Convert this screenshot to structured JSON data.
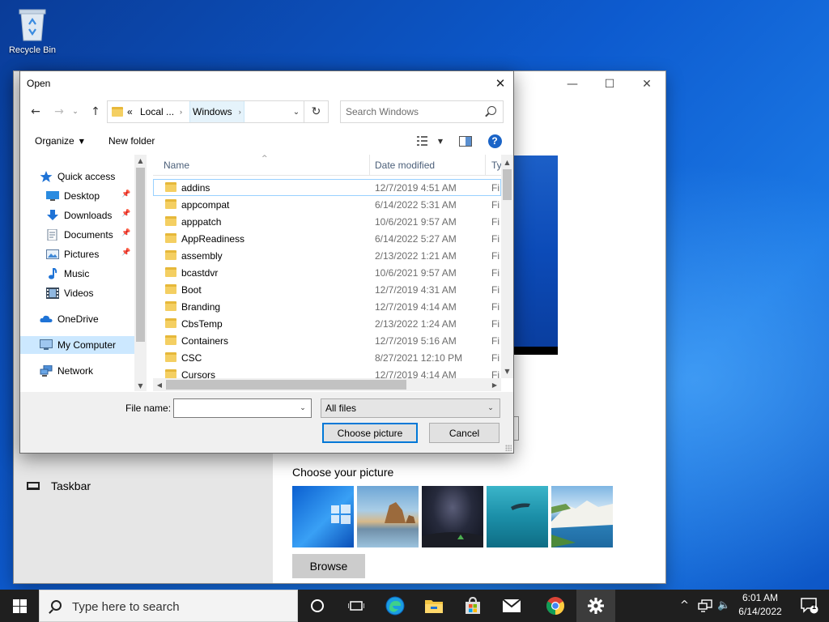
{
  "desktop": {
    "recycle_bin_label": "Recycle Bin"
  },
  "settings": {
    "taskbar_label": "Taskbar",
    "choose_picture_label": "Choose your picture",
    "browse_label": "Browse",
    "minimize": "—",
    "maximize": "☐",
    "close": "✕",
    "thumbnails": [
      "windows-logo-wallpaper",
      "beach-rocks-wallpaper",
      "night-sky-wallpaper",
      "underwater-swimmer-wallpaper",
      "white-cliffs-wallpaper"
    ]
  },
  "dialog": {
    "title": "Open",
    "close": "✕",
    "address": {
      "overflow": "«",
      "segments": [
        "Local ...",
        "Windows"
      ],
      "separator": "›"
    },
    "search_placeholder": "Search Windows",
    "toolbar": {
      "organize": "Organize",
      "new_folder": "New folder"
    },
    "nav_pane": [
      {
        "label": "Quick access",
        "icon": "star-icon",
        "pinned": false
      },
      {
        "label": "Desktop",
        "icon": "desktop-icon",
        "pinned": true
      },
      {
        "label": "Downloads",
        "icon": "download-arrow-icon",
        "pinned": true
      },
      {
        "label": "Documents",
        "icon": "documents-icon",
        "pinned": true
      },
      {
        "label": "Pictures",
        "icon": "pictures-icon",
        "pinned": true
      },
      {
        "label": "Music",
        "icon": "music-note-icon",
        "pinned": false
      },
      {
        "label": "Videos",
        "icon": "film-icon",
        "pinned": false
      },
      {
        "label": "OneDrive",
        "icon": "cloud-icon",
        "pinned": false
      },
      {
        "label": "My Computer",
        "icon": "computer-icon",
        "pinned": false
      },
      {
        "label": "Network",
        "icon": "network-icon",
        "pinned": false
      }
    ],
    "columns": {
      "name": "Name",
      "date": "Date modified",
      "type": "Ty"
    },
    "files": [
      {
        "name": "addins",
        "date": "12/7/2019 4:51 AM",
        "type": "Fi"
      },
      {
        "name": "appcompat",
        "date": "6/14/2022 5:31 AM",
        "type": "Fi"
      },
      {
        "name": "apppatch",
        "date": "10/6/2021 9:57 AM",
        "type": "Fi"
      },
      {
        "name": "AppReadiness",
        "date": "6/14/2022 5:27 AM",
        "type": "Fi"
      },
      {
        "name": "assembly",
        "date": "2/13/2022 1:21 AM",
        "type": "Fi"
      },
      {
        "name": "bcastdvr",
        "date": "10/6/2021 9:57 AM",
        "type": "Fi"
      },
      {
        "name": "Boot",
        "date": "12/7/2019 4:31 AM",
        "type": "Fi"
      },
      {
        "name": "Branding",
        "date": "12/7/2019 4:14 AM",
        "type": "Fi"
      },
      {
        "name": "CbsTemp",
        "date": "2/13/2022 1:24 AM",
        "type": "Fi"
      },
      {
        "name": "Containers",
        "date": "12/7/2019 5:16 AM",
        "type": "Fi"
      },
      {
        "name": "CSC",
        "date": "8/27/2021 12:10 PM",
        "type": "Fi"
      },
      {
        "name": "Cursors",
        "date": "12/7/2019 4:14 AM",
        "type": "Fi"
      }
    ],
    "file_name_label": "File name:",
    "file_name_value": "",
    "file_type": "All files",
    "choose_button": "Choose picture",
    "cancel_button": "Cancel"
  },
  "taskbar": {
    "search_placeholder": "Type here to search",
    "apps": [
      "cortana-circle-icon",
      "task-view-icon",
      "edge-icon",
      "file-explorer-icon",
      "store-icon",
      "mail-icon",
      "chrome-icon",
      "settings-gear-icon"
    ],
    "time": "6:01 AM",
    "date": "6/14/2022",
    "notification_count": "1"
  },
  "colors": {
    "accent": "#0078d7",
    "desktop_blue": "#0d5bcf",
    "taskbar": "#1f1f1f",
    "selection": "#cce8ff",
    "folder": "#f4cf62"
  }
}
